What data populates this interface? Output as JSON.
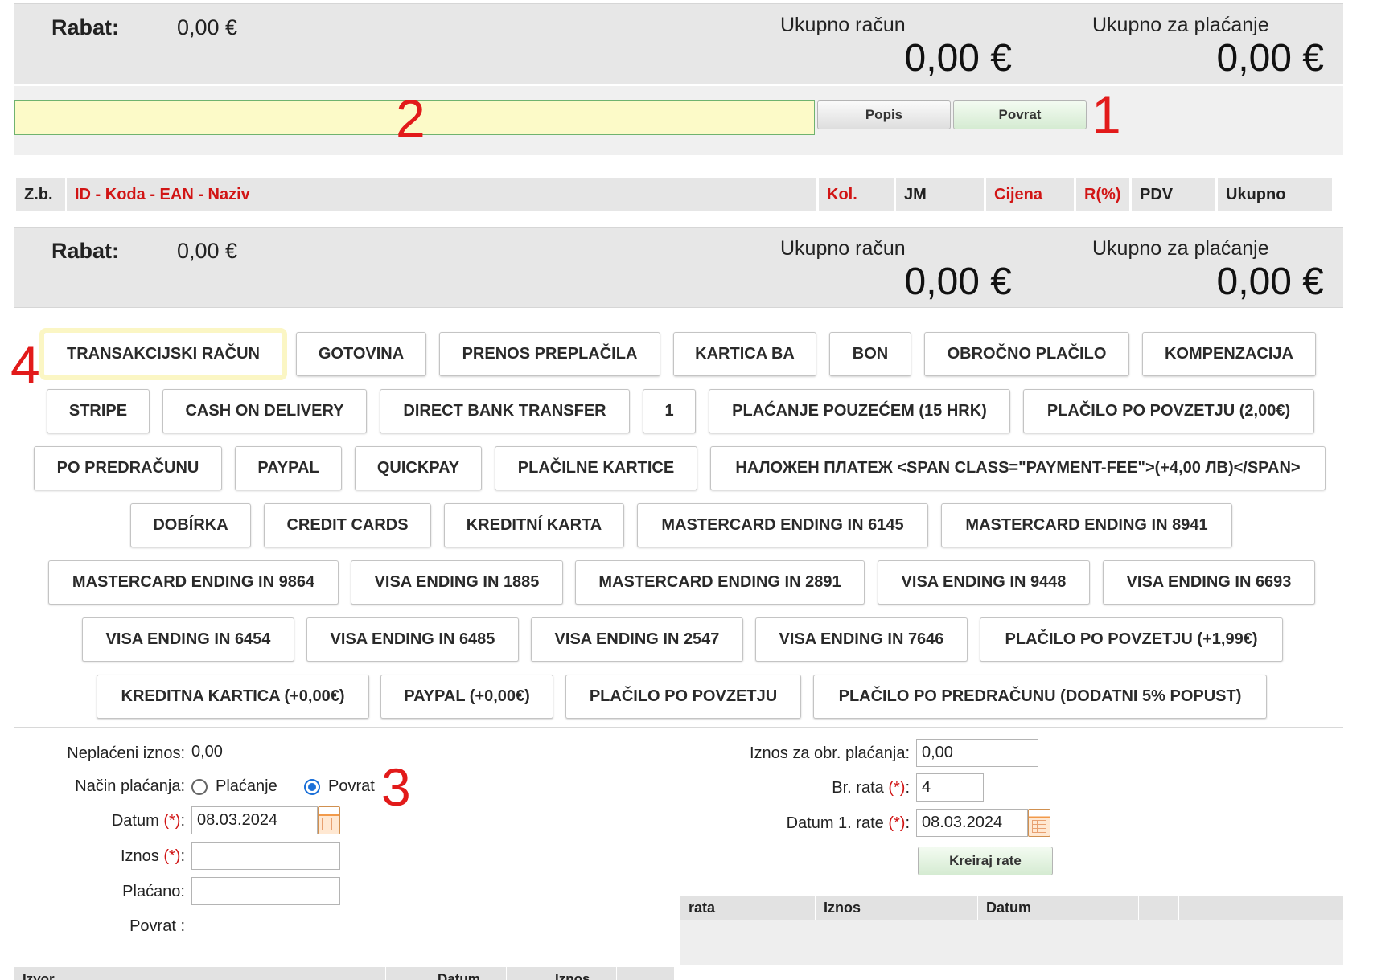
{
  "totals": {
    "rabat_label": "Rabat:",
    "rabat_value": "0,00 €",
    "ukupno_racun_label": "Ukupno račun",
    "ukupno_racun_value": "0,00 €",
    "ukupno_placanje_label": "Ukupno za plaćanje",
    "ukupno_placanje_value": "0,00 €"
  },
  "toolbar": {
    "search_value": "",
    "popis_label": "Popis",
    "povrat_label": "Povrat"
  },
  "annotations": [
    "1",
    "2",
    "3",
    "4"
  ],
  "items_table": {
    "columns": [
      "Z.b.",
      "ID - Koda - EAN - Naziv",
      "Kol.",
      "JM",
      "Cijena",
      "R(%)",
      "PDV",
      "Ukupno"
    ]
  },
  "payment_methods": [
    [
      "TRANSAKCIJSKI RAČUN",
      "GOTOVINA",
      "PRENOS PREPLAČILA",
      "KARTICA BA",
      "BON",
      "OBROČNO PLAČILO",
      "KOMPENZACIJA"
    ],
    [
      "STRIPE",
      "CASH ON DELIVERY",
      "DIRECT BANK TRANSFER",
      "1",
      "PLAĆANJE POUZEĆEM (15 HRK)",
      "PLAČILO PO POVZETJU (2,00€)"
    ],
    [
      "PO PREDRAČUNU",
      "PAYPAL",
      "QUICKPAY",
      "PLAČILNE KARTICE",
      "НАЛОЖЕН ПЛАТЕЖ <SPAN CLASS=\"PAYMENT-FEE\">(+4,00 ЛВ)</SPAN>"
    ],
    [
      "DOBÍRKA",
      "CREDIT CARDS",
      "KREDITNÍ KARTA",
      "MASTERCARD ENDING IN 6145",
      "MASTERCARD ENDING IN 8941"
    ],
    [
      "MASTERCARD ENDING IN 9864",
      "VISA ENDING IN 1885",
      "MASTERCARD ENDING IN 2891",
      "VISA ENDING IN 9448",
      "VISA ENDING IN 6693"
    ],
    [
      "VISA ENDING IN 6454",
      "VISA ENDING IN 6485",
      "VISA ENDING IN 2547",
      "VISA ENDING IN 7646",
      "PLAČILO PO POVZETJU (+1,99€)"
    ],
    [
      "KREDITNA KARTICA (+0,00€)",
      "PAYPAL (+0,00€)",
      "PLAČILO PO POVZETJU",
      "PLAČILO PO PREDRAČUNU (DODATNI 5% POPUST)"
    ]
  ],
  "payment_form": {
    "neplaceni_label": "Neplaćeni iznos:",
    "neplaceni_value": "0,00",
    "nacin_label": "Način plaćanja:",
    "radio_placanje": "Plaćanje",
    "radio_povrat": "Povrat",
    "datum_label": "Datum",
    "required_mark": "(*)",
    "colon": ":",
    "datum_value": "08.03.2024",
    "iznos_label": "Iznos",
    "iznos_value": "",
    "placano_label": "Plaćano:",
    "placano_value": "",
    "povrat_label": "Povrat :"
  },
  "installments": {
    "iznos_label": "Iznos za obr. plaćanja:",
    "iznos_value": "0,00",
    "br_rata_label": "Br. rata",
    "br_rata_value": "4",
    "datum_label": "Datum 1. rate",
    "datum_value": "08.03.2024",
    "kreiraj_label": "Kreiraj rate",
    "table_columns": [
      "rata",
      "Iznos",
      "Datum"
    ]
  },
  "bottom_table": {
    "columns": [
      "Izvor",
      "Datum",
      "Iznos"
    ]
  }
}
